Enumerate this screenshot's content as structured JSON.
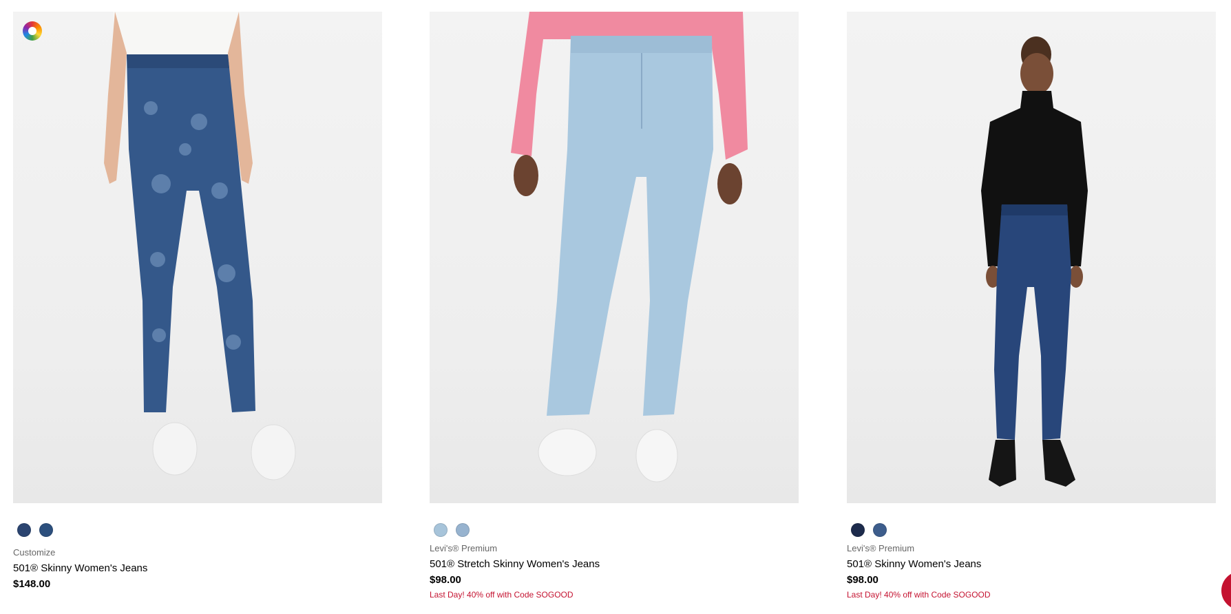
{
  "products": [
    {
      "brand": "Customize",
      "title": "501® Skinny Women's Jeans",
      "price": "$148.00",
      "promo": "",
      "image_alt": "Paisley print high-rise skinny jeans",
      "swatches": [
        "#2b4470",
        "#2c4f7d"
      ],
      "has_customize_icon": true
    },
    {
      "brand": "Levi's® Premium",
      "title": "501® Stretch Skinny Women's Jeans",
      "price": "$98.00",
      "promo": "Last Day! 40% off with Code SOGOOD",
      "image_alt": "Light wash stretch skinny jeans",
      "swatches": [
        "#a7c4da",
        "#97b3cf"
      ],
      "has_customize_icon": false
    },
    {
      "brand": "Levi's® Premium",
      "title": "501® Skinny Women's Jeans",
      "price": "$98.00",
      "promo": "Last Day! 40% off with Code SOGOOD",
      "image_alt": "Dark wash skinny jeans with black turtleneck",
      "swatches": [
        "#1d2b4c",
        "#3d5d8c"
      ],
      "has_customize_icon": false
    }
  ],
  "colors": {
    "promo": "#c41230",
    "brand_text": "#666666",
    "chat_button": "#c41230"
  }
}
